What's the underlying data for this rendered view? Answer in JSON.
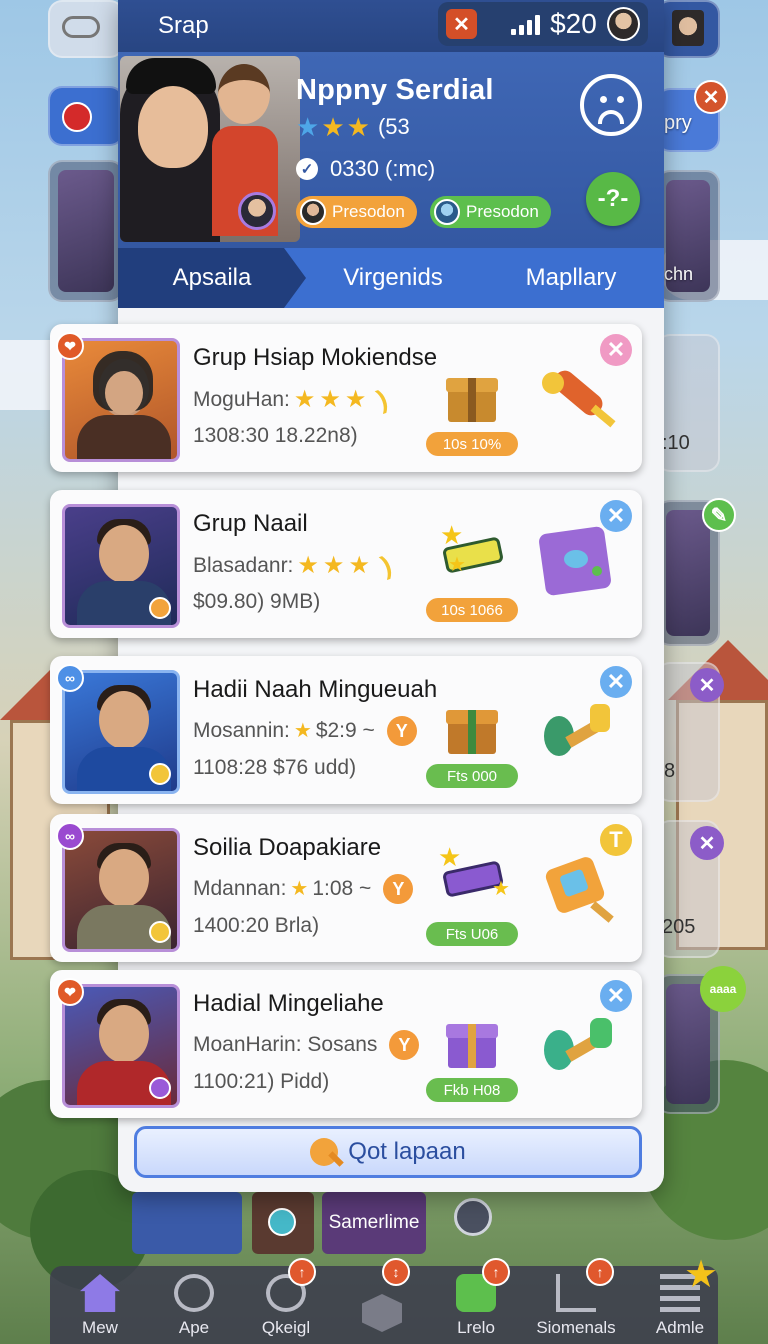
{
  "topbar": {
    "title": "Srap",
    "money": "$20"
  },
  "profile": {
    "name": "Nppny Serdial",
    "rating_text": "(53",
    "id_text": "0330 (:mc)",
    "pill_1": "Presodon",
    "pill_2": "Presodon",
    "help_label": "-?-"
  },
  "tabs": [
    {
      "label": "Apsaila",
      "active": true
    },
    {
      "label": "Virgenids",
      "active": false
    },
    {
      "label": "Mapllary",
      "active": false
    }
  ],
  "cards": [
    {
      "title": "Grup Hsiap Mokiendse",
      "meta": "MoguHan:",
      "time": "1308:30 18.22n8)",
      "price": "10s 10%",
      "price_color": "orange",
      "close_color": "#f09ac4"
    },
    {
      "title": "Grup Naail",
      "meta": "Blasadanr:",
      "time": "$09.80) 9MB)",
      "price": "10s 1066",
      "price_color": "orange",
      "close_color": "#6aaef0"
    },
    {
      "title": "Hadii Naah Mingueuah",
      "meta": "Mosannin: ",
      "meta_value": "$2:9 ~",
      "time": "1108:28 $76 udd)",
      "price": "Fts 000",
      "price_color": "green",
      "close_color": "#6aaef0"
    },
    {
      "title": "Soilia Doapakiare",
      "meta": "Mdannan: ",
      "meta_value": "1:08 ~",
      "time": "1400:20 Brla)",
      "price": "Fts U06",
      "price_color": "green",
      "close_color": "#f2c53a"
    },
    {
      "title": "Hadial Mingeliahe",
      "meta": "MoanHarin: Sosans",
      "time": "1100:21) Pidd)",
      "price": "Fkb H08",
      "price_color": "green",
      "close_color": "#6aaef0"
    }
  ],
  "cta": {
    "label": "Qot lapaan"
  },
  "background": {
    "strip_label": "Samerlime",
    "side_values": [
      "pry",
      ":10",
      "8",
      "205",
      "chn",
      "aaaa"
    ]
  },
  "navbar": [
    {
      "label": "Mew"
    },
    {
      "label": "Ape"
    },
    {
      "label": "Qkeigl"
    },
    {
      "label": ""
    },
    {
      "label": "Lrelo"
    },
    {
      "label": "Siomenals"
    },
    {
      "label": "Admle"
    }
  ],
  "colors": {
    "header_blue": "#2f4f92",
    "profile_blue": "#3458a2",
    "tab_blue": "#3c6fd0",
    "tab_active": "#213e7d",
    "accent_orange": "#f2a23b",
    "accent_green": "#5dbf4d"
  }
}
